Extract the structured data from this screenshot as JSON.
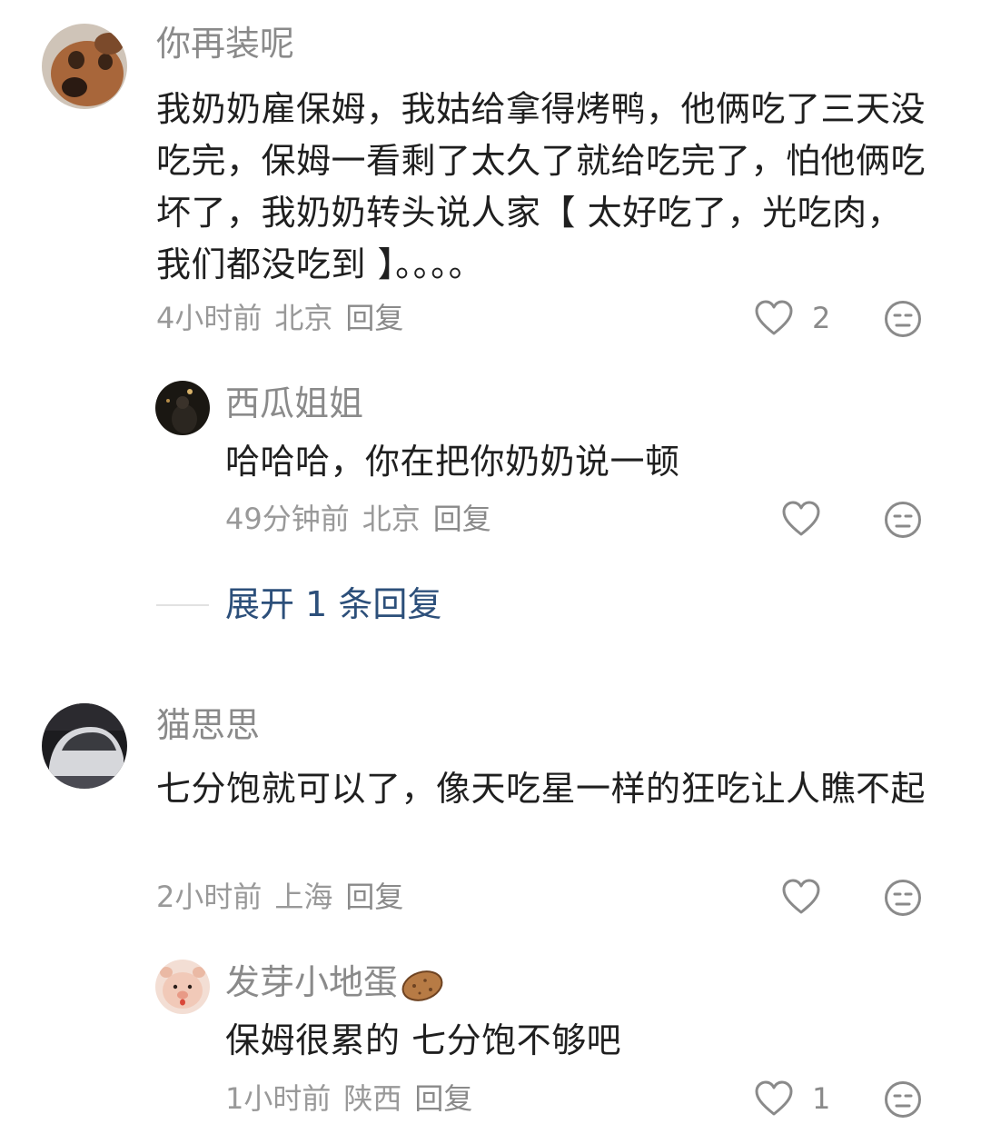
{
  "comments": [
    {
      "username": "你再装呢",
      "avatar_icon": "dog-avatar-icon",
      "text": "我奶奶雇保姆，我姑给拿得烤鸭，他俩吃了三天没吃完，保姆一看剩了太久了就给吃完了，怕他俩吃坏了，我奶奶转头说人家【 太好吃了，光吃肉，我们都没吃到 】。。。。",
      "time": "4小时前",
      "location": "北京",
      "reply_label": "回复",
      "like_count": "2",
      "replies": [
        {
          "username": "西瓜姐姐",
          "avatar_icon": "night-photo-avatar-icon",
          "text": "哈哈哈，你在把你奶奶说一顿",
          "time": "49分钟前",
          "location": "北京",
          "reply_label": "回复",
          "like_count": ""
        }
      ],
      "expand_label": "展开 1 条回复"
    },
    {
      "username": "猫思思",
      "avatar_icon": "car-photo-avatar-icon",
      "text": "七分饱就可以了，像天吃星一样的狂吃让人瞧不起",
      "time": "2小时前",
      "location": "上海",
      "reply_label": "回复",
      "like_count": "",
      "replies": [
        {
          "username": "发芽小地蛋",
          "username_emoji": "potato-emoji-icon",
          "avatar_icon": "pig-plush-avatar-icon",
          "text": "保姆很累的 七分饱不够吧",
          "time": "1小时前",
          "location": "陕西",
          "reply_label": "回复",
          "like_count": "1"
        }
      ]
    }
  ],
  "colors": {
    "name": "#8a8a8a",
    "text": "#1f1f1f",
    "meta": "#999999",
    "expand": "#2c4f7a",
    "icon": "#8a8a8a"
  }
}
